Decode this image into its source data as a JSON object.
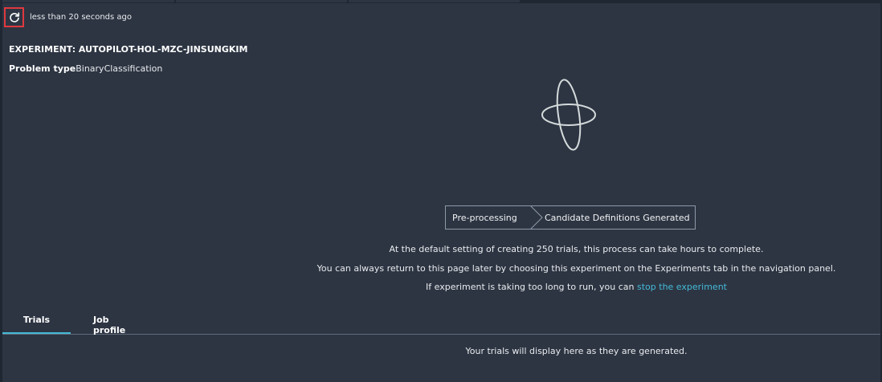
{
  "header": {
    "refresh_label": "less than 20 seconds ago"
  },
  "experiment": {
    "title": "EXPERIMENT: AUTOPILOT-HOL-MZC-JINSUNGKIM",
    "problem_type_label": "Problem type",
    "problem_type_value": "BinaryClassification"
  },
  "progress": {
    "steps": [
      "Pre-processing",
      "Candidate Definitions Generated"
    ]
  },
  "messages": {
    "line1": "At the default setting of creating 250 trials, this process can take hours to complete.",
    "line2": "You can always return to this page later by choosing this experiment on the Experiments tab in the navigation panel.",
    "line3_prefix": "If experiment is taking too long to run, you can ",
    "line3_link": "stop the experiment"
  },
  "tabs": [
    {
      "label": "Trials",
      "selected": true
    },
    {
      "label": "Job profile",
      "selected": false
    }
  ],
  "trials": {
    "empty_message": "Your trials will display here as they are generated."
  },
  "colors": {
    "background": "#2d3543",
    "accent": "#44b9d6",
    "highlight_border": "#e0393e"
  },
  "icons": {
    "refresh": "refresh-icon",
    "loading": "loading-spinner-icon",
    "step_separator": "chevron-right-icon"
  }
}
